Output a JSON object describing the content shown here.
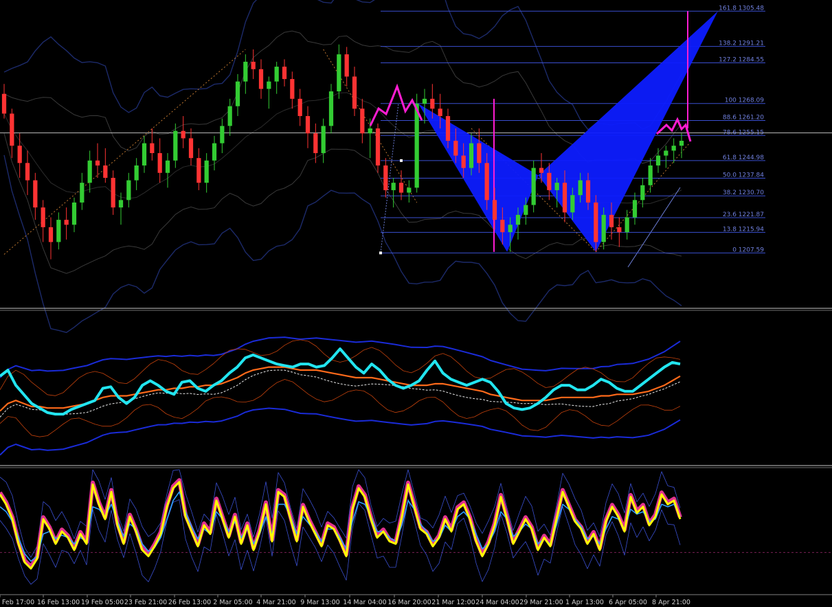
{
  "chart_data": [
    {
      "type": "candlestick",
      "panel": "main",
      "series": [
        {
          "name": "",
          "values": [
            [
              1272,
              1276,
              1262,
              1264
            ],
            [
              1264,
              1266,
              1246,
              1251
            ],
            [
              1251,
              1256,
              1238,
              1244
            ],
            [
              1244,
              1249,
              1231,
              1237
            ],
            [
              1237,
              1240,
              1221,
              1226
            ],
            [
              1226,
              1229,
              1212,
              1218
            ],
            [
              1218,
              1222,
              1205,
              1212
            ],
            [
              1212,
              1224,
              1209,
              1221
            ],
            [
              1221,
              1226,
              1213,
              1219
            ],
            [
              1219,
              1230,
              1216,
              1228
            ],
            [
              1228,
              1240,
              1225,
              1236
            ],
            [
              1236,
              1249,
              1232,
              1245
            ],
            [
              1245,
              1252,
              1238,
              1243
            ],
            [
              1243,
              1250,
              1236,
              1238
            ],
            [
              1238,
              1241,
              1223,
              1226
            ],
            [
              1226,
              1232,
              1219,
              1229
            ],
            [
              1229,
              1240,
              1226,
              1237
            ],
            [
              1237,
              1246,
              1233,
              1243
            ],
            [
              1243,
              1255,
              1240,
              1252
            ],
            [
              1252,
              1258,
              1245,
              1248
            ],
            [
              1248,
              1254,
              1236,
              1240
            ],
            [
              1240,
              1248,
              1234,
              1245
            ],
            [
              1245,
              1260,
              1242,
              1257
            ],
            [
              1257,
              1263,
              1250,
              1254
            ],
            [
              1254,
              1258,
              1243,
              1246
            ],
            [
              1246,
              1250,
              1233,
              1236
            ],
            [
              1236,
              1248,
              1232,
              1245
            ],
            [
              1245,
              1255,
              1241,
              1252
            ],
            [
              1252,
              1262,
              1248,
              1259
            ],
            [
              1259,
              1270,
              1255,
              1267
            ],
            [
              1267,
              1280,
              1263,
              1277
            ],
            [
              1277,
              1288,
              1272,
              1285
            ],
            [
              1285,
              1290,
              1278,
              1282
            ],
            [
              1282,
              1286,
              1270,
              1274
            ],
            [
              1274,
              1279,
              1266,
              1277
            ],
            [
              1277,
              1285,
              1272,
              1283
            ],
            [
              1283,
              1286,
              1275,
              1278
            ],
            [
              1278,
              1281,
              1266,
              1270
            ],
            [
              1270,
              1274,
              1259,
              1263
            ],
            [
              1263,
              1267,
              1250,
              1256
            ],
            [
              1256,
              1260,
              1244,
              1248
            ],
            [
              1248,
              1262,
              1244,
              1259
            ],
            [
              1259,
              1276,
              1256,
              1273
            ],
            [
              1273,
              1292,
              1270,
              1288
            ],
            [
              1288,
              1291,
              1275,
              1279
            ],
            [
              1279,
              1283,
              1263,
              1266
            ],
            [
              1266,
              1270,
              1252,
              1256
            ],
            [
              1256,
              1262,
              1246,
              1258
            ],
            [
              1258,
              1260,
              1240,
              1243
            ],
            [
              1243,
              1246,
              1230,
              1233
            ],
            [
              1233,
              1238,
              1226,
              1236
            ],
            [
              1236,
              1241,
              1229,
              1232
            ],
            [
              1232,
              1237,
              1228,
              1234
            ],
            [
              1234,
              1272,
              1232,
              1268
            ],
            [
              1268,
              1274,
              1260,
              1270
            ],
            [
              1270,
              1276,
              1262,
              1266
            ],
            [
              1266,
              1272,
              1258,
              1263
            ],
            [
              1263,
              1266,
              1250,
              1253
            ],
            [
              1253,
              1258,
              1244,
              1247
            ],
            [
              1247,
              1252,
              1238,
              1242
            ],
            [
              1242,
              1256,
              1239,
              1252
            ],
            [
              1252,
              1258,
              1240,
              1244
            ],
            [
              1244,
              1248,
              1225,
              1229
            ],
            [
              1229,
              1234,
              1217,
              1221
            ],
            [
              1221,
              1226,
              1211,
              1216
            ],
            [
              1216,
              1222,
              1208,
              1219
            ],
            [
              1219,
              1226,
              1213,
              1223
            ],
            [
              1223,
              1230,
              1219,
              1227
            ],
            [
              1227,
              1245,
              1224,
              1242
            ],
            [
              1242,
              1248,
              1236,
              1240
            ],
            [
              1240,
              1244,
              1229,
              1233
            ],
            [
              1233,
              1238,
              1226,
              1236
            ],
            [
              1236,
              1241,
              1220,
              1224
            ],
            [
              1224,
              1234,
              1221,
              1231
            ],
            [
              1231,
              1240,
              1228,
              1237
            ],
            [
              1237,
              1240,
              1225,
              1228
            ],
            [
              1228,
              1231,
              1208,
              1212
            ],
            [
              1212,
              1226,
              1209,
              1223
            ],
            [
              1223,
              1228,
              1213,
              1218
            ],
            [
              1218,
              1222,
              1210,
              1216
            ],
            [
              1216,
              1225,
              1213,
              1222
            ],
            [
              1222,
              1232,
              1219,
              1229
            ],
            [
              1229,
              1238,
              1226,
              1235
            ],
            [
              1235,
              1246,
              1232,
              1243
            ],
            [
              1243,
              1250,
              1240,
              1247
            ],
            [
              1247,
              1251,
              1242,
              1249
            ],
            [
              1249,
              1254,
              1244,
              1251
            ],
            [
              1251,
              1256,
              1246,
              1253
            ]
          ]
        }
      ],
      "fib_levels": [
        {
          "label": "161.8 1305.48",
          "value": 1305.48
        },
        {
          "label": "138.2 1291.21",
          "value": 1291.21
        },
        {
          "label": "127.2 1284.55",
          "value": 1284.55
        },
        {
          "label": "100 1268.09",
          "value": 1268.09
        },
        {
          "label": "88.6 1261.20",
          "value": 1261.2
        },
        {
          "label": "78.6 1255.15",
          "value": 1255.15
        },
        {
          "label": "61.8 1244.98",
          "value": 1244.98
        },
        {
          "label": "50.0 1237.84",
          "value": 1237.84
        },
        {
          "label": "38.2 1230.70",
          "value": 1230.7
        },
        {
          "label": "23.6 1221.87",
          "value": 1221.87
        },
        {
          "label": "13.8 1215.94",
          "value": 1215.94
        },
        {
          "label": "0 1207.59",
          "value": 1207.59
        }
      ],
      "ylim": [
        1186,
        1310
      ],
      "horizontal_line": 1256.2,
      "grid": false
    },
    {
      "type": "line",
      "panel": "oscillator-1",
      "ylim": [
        0,
        100
      ],
      "series": [
        {
          "name": "",
          "color": "#22e5f0",
          "values": [
            58,
            62,
            52,
            46,
            40,
            37,
            34,
            33,
            33,
            36,
            38,
            40,
            42,
            50,
            51,
            44,
            40,
            44,
            52,
            55,
            52,
            48,
            46,
            54,
            55,
            50,
            48,
            52,
            55,
            60,
            64,
            70,
            72,
            70,
            68,
            66,
            65,
            64,
            66,
            66,
            64,
            65,
            70,
            76,
            70,
            64,
            60,
            66,
            62,
            56,
            52,
            50,
            52,
            55,
            62,
            68,
            60,
            56,
            54,
            52,
            54,
            56,
            54,
            48,
            40,
            37,
            36,
            37,
            40,
            44,
            49,
            52,
            52,
            49,
            49,
            52,
            56,
            54,
            50,
            48,
            48,
            52,
            56,
            60,
            64,
            67,
            66
          ]
        },
        {
          "name": "",
          "color": "#ff6a1a",
          "values": [
            35,
            40,
            42,
            40,
            38,
            38,
            37,
            37,
            37,
            38,
            39,
            40,
            42,
            44,
            45,
            45,
            45,
            46,
            47,
            48,
            49,
            49,
            50,
            50,
            51,
            51,
            52,
            52,
            53,
            55,
            57,
            60,
            62,
            63,
            64,
            64,
            64,
            63,
            62,
            62,
            62,
            61,
            60,
            59,
            58,
            57,
            57,
            57,
            56,
            55,
            54,
            53,
            52,
            52,
            52,
            53,
            53,
            52,
            51,
            50,
            49,
            48,
            46,
            45,
            44,
            43,
            42,
            42,
            42,
            42,
            43,
            44,
            44,
            44,
            44,
            44,
            45,
            45,
            46,
            46,
            46,
            47,
            48,
            50,
            52,
            55,
            58
          ]
        }
      ]
    },
    {
      "type": "line",
      "panel": "oscillator-2",
      "ylim": [
        0,
        100
      ],
      "series": [
        {
          "name": "",
          "color": "#ffff00",
          "values": [
            80,
            72,
            60,
            40,
            25,
            20,
            28,
            60,
            52,
            40,
            50,
            45,
            35,
            48,
            40,
            88,
            72,
            60,
            82,
            55,
            40,
            62,
            50,
            35,
            30,
            38,
            48,
            70,
            85,
            90,
            62,
            50,
            38,
            55,
            48,
            75,
            60,
            45,
            62,
            40,
            55,
            35,
            50,
            72,
            42,
            82,
            78,
            60,
            42,
            70,
            58,
            48,
            38,
            55,
            52,
            42,
            30,
            68,
            85,
            78,
            60,
            45,
            50,
            42,
            40,
            62,
            88,
            70,
            52,
            48,
            38,
            45,
            60,
            50,
            68,
            72,
            60,
            42,
            30,
            40,
            55,
            78,
            60,
            40,
            50,
            60,
            52,
            35,
            45,
            38,
            60,
            82,
            70,
            58,
            52,
            40,
            48,
            35,
            58,
            70,
            62,
            50,
            78,
            65,
            70,
            55,
            62,
            80,
            72,
            75,
            60
          ]
        },
        {
          "name": "",
          "color": "#2e9fff",
          "values": [
            70,
            66,
            58,
            45,
            32,
            26,
            30,
            48,
            50,
            44,
            47,
            45,
            40,
            45,
            42,
            70,
            68,
            62,
            72,
            58,
            46,
            56,
            52,
            40,
            34,
            37,
            45,
            60,
            75,
            82,
            66,
            54,
            44,
            52,
            48,
            66,
            60,
            50,
            58,
            45,
            52,
            40,
            48,
            62,
            48,
            72,
            72,
            62,
            48,
            62,
            56,
            50,
            42,
            52,
            52,
            45,
            36,
            58,
            74,
            72,
            62,
            50,
            50,
            45,
            42,
            55,
            75,
            68,
            56,
            50,
            42,
            44,
            55,
            50,
            62,
            66,
            60,
            48,
            36,
            40,
            50,
            66,
            60,
            46,
            50,
            56,
            52,
            40,
            44,
            40,
            55,
            72,
            68,
            60,
            54,
            44,
            46,
            40,
            52,
            62,
            60,
            52,
            68,
            64,
            66,
            58,
            60,
            72,
            70,
            72,
            62
          ]
        }
      ]
    }
  ],
  "x_axis": {
    "tick_labels": [
      "1 Feb 17:00",
      "16 Feb 13:00",
      "19 Feb 05:00",
      "23 Feb 21:00",
      "26 Feb 13:00",
      "2 Mar 05:00",
      "4 Mar 21:00",
      "9 Mar 13:00",
      "14 Mar 04:00",
      "16 Mar 20:00",
      "21 Mar 12:00",
      "24 Mar 04:00",
      "29 Mar 21:00",
      "1 Apr 13:00",
      "6 Apr 05:00",
      "8 Apr 21:00"
    ]
  },
  "colors": {
    "background": "#000000",
    "bull_candle": "#33cc33",
    "bear_candle": "#ff3333",
    "fib_line": "#3a4fd0",
    "pattern_fill": "#0d1cff",
    "zigzag": "#ff1dd2",
    "panel_separator": "#c0c0c0"
  }
}
